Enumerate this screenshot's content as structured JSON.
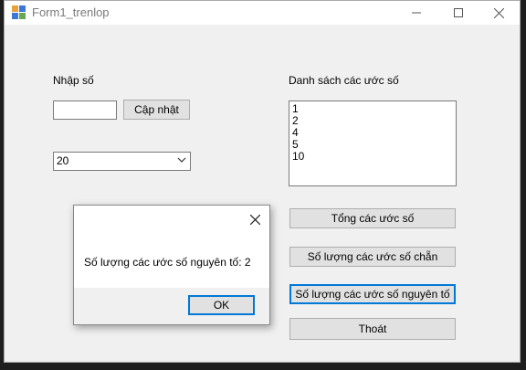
{
  "window": {
    "title": "Form1_trenlop"
  },
  "form": {
    "input_label": "Nhập số",
    "input_value": "",
    "update_button": "Cập nhật",
    "combo_value": "20",
    "list_label": "Danh sách các ước số",
    "divisors": [
      "1",
      "2",
      "4",
      "5",
      "10"
    ],
    "sum_button": "Tổng các ước số",
    "even_count_button": "Số lượng các ước số chẵn",
    "prime_count_button": "Số lượng các ước số nguyên tố",
    "exit_button": "Thoát"
  },
  "dialog": {
    "message": "Số lượng các ước số nguyên tố: 2",
    "ok_button": "OK"
  },
  "icons": {
    "app": "winforms-app-icon",
    "minimize": "minimize-icon",
    "maximize": "maximize-icon",
    "close": "close-icon"
  }
}
